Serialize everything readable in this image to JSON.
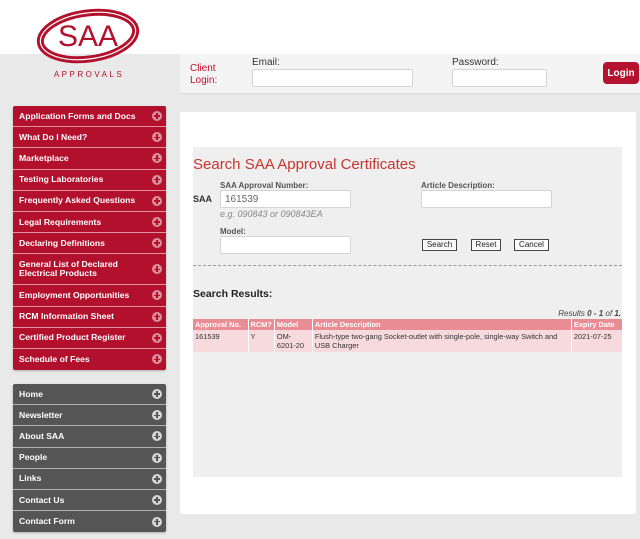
{
  "brand": {
    "logo_text": "SAA",
    "logo_subtext": "APPROVALS",
    "colors": {
      "primary": "#b3102d",
      "accent": "#c8352e",
      "nav_dark": "#555555",
      "table_header": "#e98c93",
      "table_row": "#f7dadd"
    }
  },
  "login": {
    "client_login": "Client Login:",
    "email_label": "Email:",
    "email_value": "",
    "password_label": "Password:",
    "password_value": "",
    "login_button": "Login"
  },
  "sidebar": {
    "primary_items": [
      {
        "label": "Application Forms and Docs",
        "icon": "plus-circle-icon"
      },
      {
        "label": "What Do I Need?",
        "icon": "plus-circle-icon"
      },
      {
        "label": "Marketplace",
        "icon": "plus-circle-icon"
      },
      {
        "label": "Testing Laboratories",
        "icon": "plus-circle-icon"
      },
      {
        "label": "Frequently Asked Questions",
        "icon": "plus-circle-icon"
      },
      {
        "label": "Legal Requirements",
        "icon": "plus-circle-icon"
      },
      {
        "label": "Declaring Definitions",
        "icon": "plus-circle-icon"
      },
      {
        "label": "General List of Declared Electrical Products",
        "icon": "plus-circle-icon"
      },
      {
        "label": "Employment Opportunities",
        "icon": "plus-circle-icon"
      },
      {
        "label": "RCM Information Sheet",
        "icon": "plus-circle-icon"
      },
      {
        "label": "Certified Product Register",
        "icon": "plus-circle-icon"
      },
      {
        "label": "Schedule of Fees",
        "icon": "plus-circle-icon"
      }
    ],
    "secondary_items": [
      {
        "label": "Home",
        "icon": "plus-circle-icon"
      },
      {
        "label": "Newsletter",
        "icon": "plus-circle-icon"
      },
      {
        "label": "About SAA",
        "icon": "plus-circle-icon"
      },
      {
        "label": "People",
        "icon": "plus-circle-icon"
      },
      {
        "label": "Links",
        "icon": "plus-circle-icon"
      },
      {
        "label": "Contact Us",
        "icon": "plus-circle-icon"
      },
      {
        "label": "Contact Form",
        "icon": "plus-circle-icon"
      }
    ]
  },
  "search": {
    "title": "Search SAA Approval Certificates",
    "approval_number_label": "SAA Approval Number:",
    "approval_prefix": "SAA",
    "approval_number_value": "161539",
    "approval_hint": "e.g. 090843 or 090843EA",
    "article_label": "Article Description:",
    "article_value": "",
    "model_label": "Model:",
    "model_value": "",
    "search_button": "Search",
    "reset_button": "Reset",
    "cancel_button": "Cancel"
  },
  "results": {
    "heading": "Search Results:",
    "count_prefix": "Results",
    "count_range": "0 - 1",
    "count_of": "of",
    "count_total": "1.",
    "columns": [
      "Approval No.",
      "RCM?",
      "Model",
      "Article Description",
      "Expiry Date"
    ],
    "rows": [
      {
        "approval_no": "161539",
        "rcm": "Y",
        "model": "OM-6201-20",
        "description": "Flush-type two-gang Socket-outlet with single-pole, single-way Switch and USB Charger",
        "expiry": "2021-07-25"
      }
    ]
  }
}
